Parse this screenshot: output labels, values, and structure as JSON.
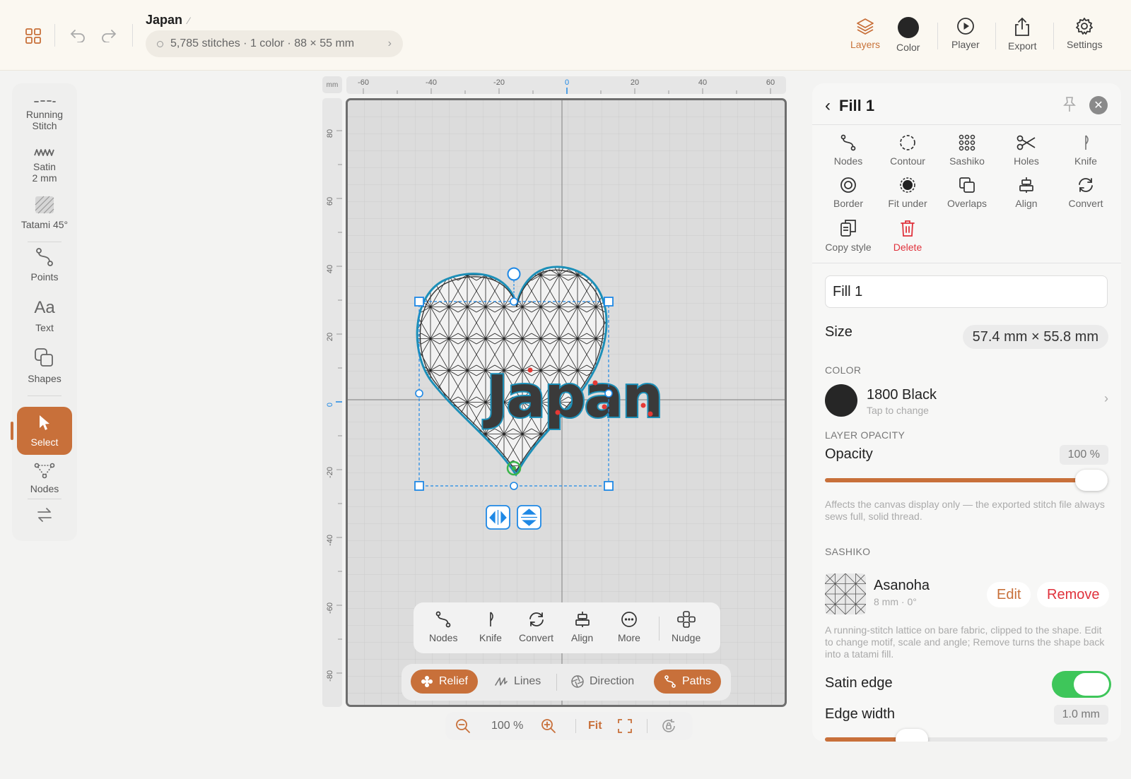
{
  "document": {
    "title": "Japan",
    "info": "5,785 stitches · 1 color · 88 × 55 mm"
  },
  "toolbar": {
    "layers_label": "Layers",
    "color_label": "Color",
    "player_label": "Player",
    "export_label": "Export",
    "settings_label": "Settings",
    "current_color": "#262626"
  },
  "left_tools": {
    "running_stitch": "Running\nStitch",
    "satin": "Satin\n2 mm",
    "tatami": "Tatami 45°",
    "points": "Points",
    "text": "Text",
    "shapes": "Shapes",
    "select": "Select",
    "nodes": "Nodes"
  },
  "rulers": {
    "unit": "mm",
    "x_ticks": [
      "-60",
      "-40",
      "-20",
      "0",
      "20",
      "40",
      "60"
    ],
    "y_ticks": [
      "80",
      "60",
      "40",
      "20",
      "0",
      "-20",
      "-40",
      "-60",
      "-80"
    ]
  },
  "canvas": {
    "design_text": "Japan"
  },
  "float_tools": {
    "nodes": "Nodes",
    "knife": "Knife",
    "convert": "Convert",
    "align": "Align",
    "more": "More",
    "nudge": "Nudge"
  },
  "view_modes": {
    "relief": "Relief",
    "lines": "Lines",
    "direction": "Direction",
    "paths": "Paths"
  },
  "zoom": {
    "level": "100 %",
    "fit": "Fit"
  },
  "panel": {
    "title": "Fill 1",
    "tools": {
      "nodes": "Nodes",
      "contour": "Contour",
      "sashiko": "Sashiko",
      "holes": "Holes",
      "knife": "Knife",
      "border": "Border",
      "fit_under": "Fit under",
      "overlaps": "Overlaps",
      "align": "Align",
      "convert": "Convert",
      "copy_style": "Copy style",
      "delete": "Delete"
    },
    "name_value": "Fill 1",
    "size_label": "Size",
    "size_value": "57.4 mm × 55.8 mm",
    "color_section": "COLOR",
    "color_name": "1800 Black",
    "color_hint": "Tap to change",
    "color_hex": "#262626",
    "opacity_section": "LAYER OPACITY",
    "opacity_label": "Opacity",
    "opacity_value": "100 %",
    "opacity_level": 1.0,
    "opacity_note": "Affects the canvas display only — the exported stitch file always sews full, solid thread.",
    "sashiko_section": "SASHIKO",
    "sashiko_name": "Asanoha",
    "sashiko_meta": "8 mm · 0°",
    "sashiko_edit": "Edit",
    "sashiko_remove": "Remove",
    "sashiko_note": "A running-stitch lattice on bare fabric, clipped to the shape. Edit to change motif, scale and angle; Remove turns the shape back into a tatami fill.",
    "satin_edge_label": "Satin edge",
    "satin_edge_on": true,
    "edge_width_label": "Edge width",
    "edge_width_value": "1.0 mm"
  },
  "colors": {
    "accent": "#c8703a",
    "danger": "#e0323c",
    "toggle_on": "#3ec65a",
    "selection": "#1e88e5"
  }
}
